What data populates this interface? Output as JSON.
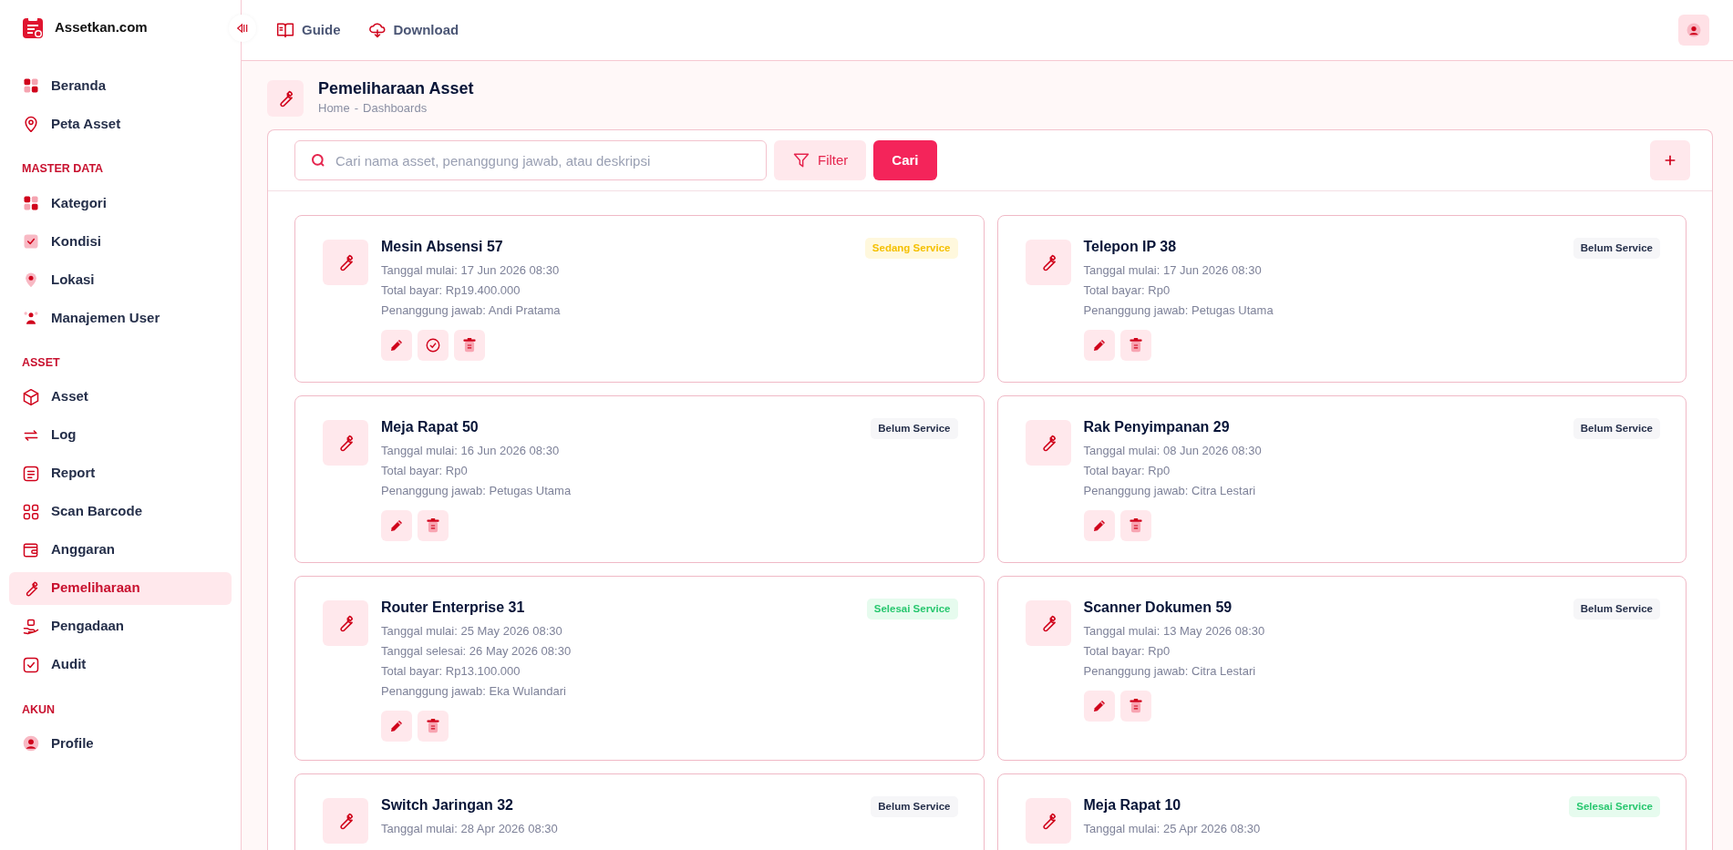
{
  "brand": {
    "name": "Assetkan.com"
  },
  "sidebar": {
    "sections": [
      {
        "items": [
          {
            "label": "Beranda",
            "selected": false
          },
          {
            "label": "Peta Asset",
            "selected": false
          }
        ]
      },
      {
        "title": "MASTER DATA",
        "items": [
          {
            "label": "Kategori",
            "selected": false
          },
          {
            "label": "Kondisi",
            "selected": false
          },
          {
            "label": "Lokasi",
            "selected": false
          },
          {
            "label": "Manajemen User",
            "selected": false
          }
        ]
      },
      {
        "title": "ASSET",
        "items": [
          {
            "label": "Asset",
            "selected": false
          },
          {
            "label": "Log",
            "selected": false
          },
          {
            "label": "Report",
            "selected": false
          },
          {
            "label": "Scan Barcode",
            "selected": false
          },
          {
            "label": "Anggaran",
            "selected": false
          },
          {
            "label": "Pemeliharaan",
            "selected": true
          },
          {
            "label": "Pengadaan",
            "selected": false
          },
          {
            "label": "Audit",
            "selected": false
          }
        ]
      },
      {
        "title": "AKUN",
        "items": [
          {
            "label": "Profile",
            "selected": false
          }
        ]
      }
    ]
  },
  "topbar": {
    "links": [
      {
        "label": "Guide"
      },
      {
        "label": "Download"
      }
    ]
  },
  "page": {
    "title": "Pemeliharaan Asset",
    "breadcrumb": {
      "items": [
        "Home",
        "Dashboards"
      ],
      "separator": "-"
    }
  },
  "toolbar": {
    "search": {
      "placeholder": "Cari nama asset, penanggung jawab, atau deskripsi"
    },
    "filter_label": "Filter",
    "search_button": "Cari"
  },
  "cards": [
    {
      "title": "Mesin Absensi 57",
      "status": {
        "label": "Sedang Service",
        "kind": "in_progress"
      },
      "details": [
        "Tanggal mulai: 17 Jun 2026 08:30",
        "Total bayar: Rp19.400.000",
        "Penanggung jawab: Andi Pratama"
      ],
      "actions": [
        {
          "kind": "edit"
        },
        {
          "kind": "complete"
        },
        {
          "kind": "delete"
        }
      ]
    },
    {
      "title": "Telepon IP 38",
      "status": {
        "label": "Belum Service",
        "kind": "pending"
      },
      "details": [
        "Tanggal mulai: 17 Jun 2026 08:30",
        "Total bayar: Rp0",
        "Penanggung jawab: Petugas Utama"
      ],
      "actions": [
        {
          "kind": "edit"
        },
        {
          "kind": "delete"
        }
      ]
    },
    {
      "title": "Meja Rapat 50",
      "status": {
        "label": "Belum Service",
        "kind": "pending"
      },
      "details": [
        "Tanggal mulai: 16 Jun 2026 08:30",
        "Total bayar: Rp0",
        "Penanggung jawab: Petugas Utama"
      ],
      "actions": [
        {
          "kind": "edit"
        },
        {
          "kind": "delete"
        }
      ]
    },
    {
      "title": "Rak Penyimpanan 29",
      "status": {
        "label": "Belum Service",
        "kind": "pending"
      },
      "details": [
        "Tanggal mulai: 08 Jun 2026 08:30",
        "Total bayar: Rp0",
        "Penanggung jawab: Citra Lestari"
      ],
      "actions": [
        {
          "kind": "edit"
        },
        {
          "kind": "delete"
        }
      ]
    },
    {
      "title": "Router Enterprise 31",
      "status": {
        "label": "Selesai Service",
        "kind": "done"
      },
      "details": [
        "Tanggal mulai: 25 May 2026 08:30",
        "Tanggal selesai: 26 May 2026 08:30",
        "Total bayar: Rp13.100.000",
        "Penanggung jawab: Eka Wulandari"
      ],
      "actions": [
        {
          "kind": "edit"
        },
        {
          "kind": "delete"
        }
      ]
    },
    {
      "title": "Scanner Dokumen 59",
      "status": {
        "label": "Belum Service",
        "kind": "pending"
      },
      "details": [
        "Tanggal mulai: 13 May 2026 08:30",
        "Total bayar: Rp0",
        "Penanggung jawab: Citra Lestari"
      ],
      "actions": [
        {
          "kind": "edit"
        },
        {
          "kind": "delete"
        }
      ]
    },
    {
      "title": "Switch Jaringan 32",
      "status": {
        "label": "Belum Service",
        "kind": "pending"
      },
      "details": [
        "Tanggal mulai: 28 Apr 2026 08:30"
      ]
    },
    {
      "title": "Meja Rapat 10",
      "status": {
        "label": "Selesai Service",
        "kind": "done"
      },
      "details": [
        "Tanggal mulai: 25 Apr 2026 08:30"
      ]
    }
  ]
}
